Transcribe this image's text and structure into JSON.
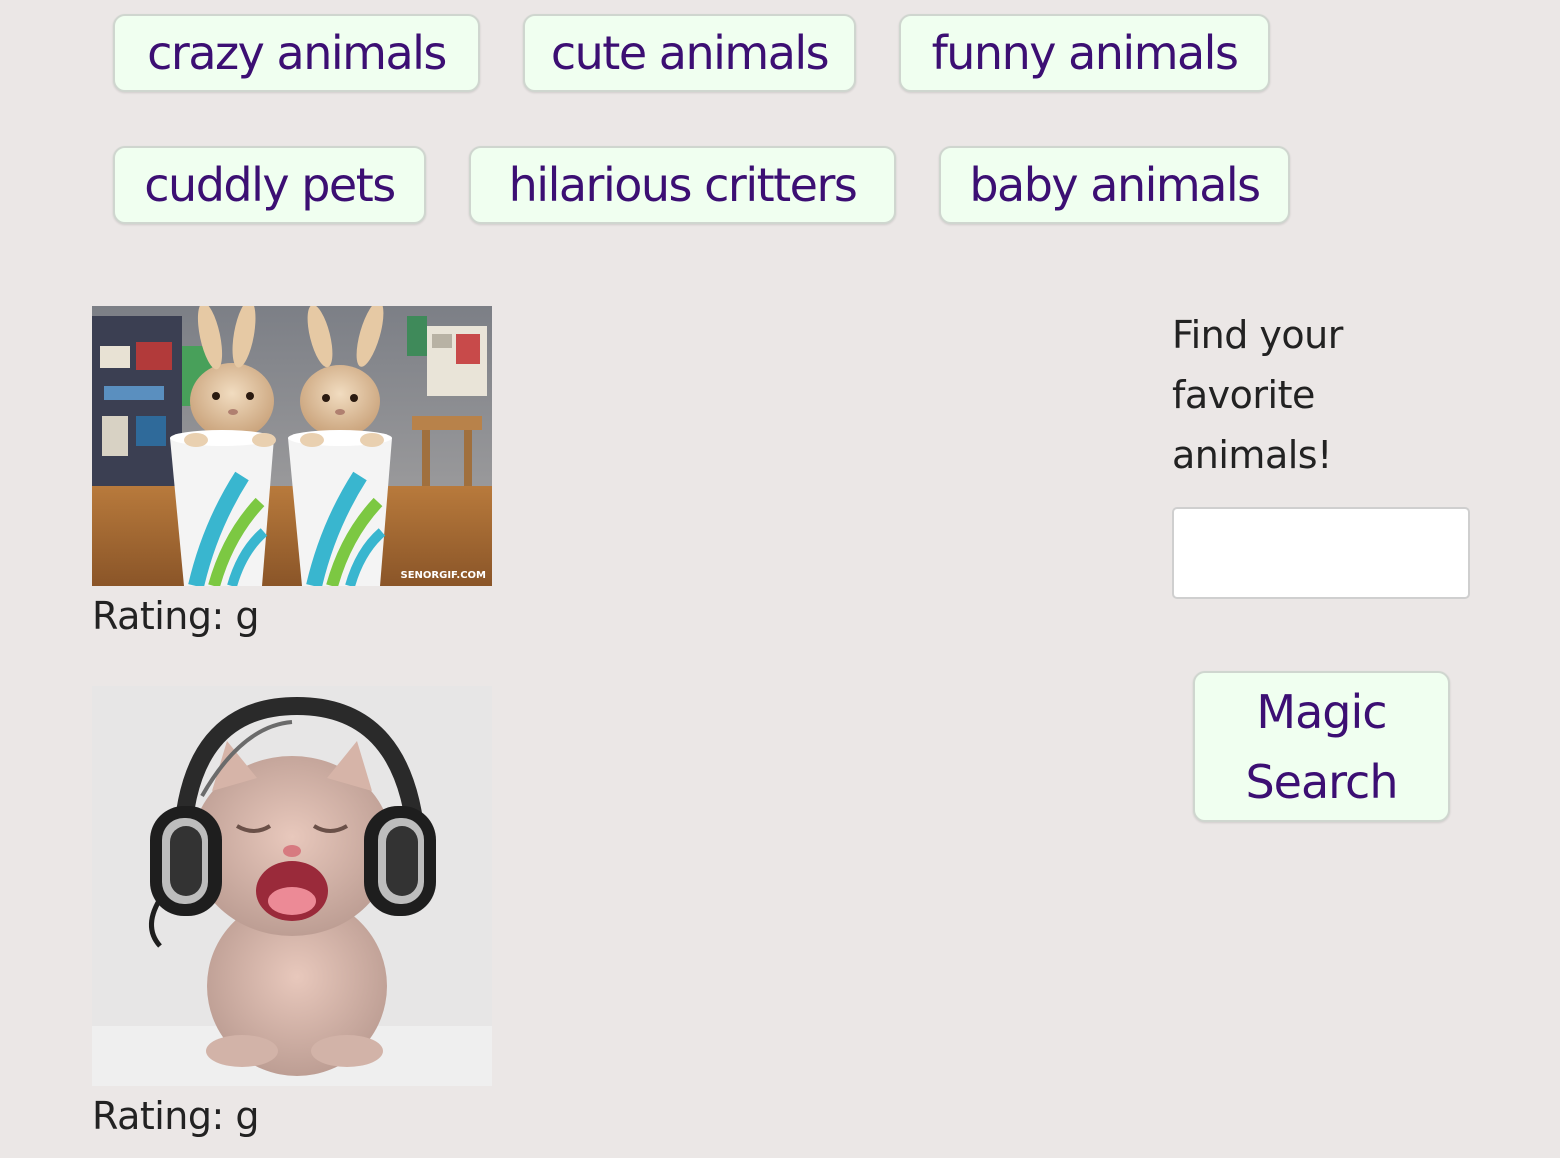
{
  "topic_buttons": [
    {
      "label": "crazy animals"
    },
    {
      "label": "cute animals"
    },
    {
      "label": "funny animals"
    },
    {
      "label": "cuddly pets"
    },
    {
      "label": "hilarious critters"
    },
    {
      "label": "baby animals"
    }
  ],
  "results": [
    {
      "image": "two-bunnies-in-cups",
      "watermark": "SENORGIF.COM",
      "rating_text": "Rating: g"
    },
    {
      "image": "kitten-with-headphones",
      "rating_text": "Rating: g"
    }
  ],
  "sidebar": {
    "prompt_lines": [
      "Find your",
      "favorite",
      "animals!"
    ],
    "search_value": "",
    "search_placeholder": "",
    "magic_button_lines": [
      "Magic",
      "Search"
    ]
  },
  "colors": {
    "page_background": "#ebe7e6",
    "button_background": "#f0fff0",
    "button_text": "#3c0f73",
    "body_text": "#222222"
  }
}
